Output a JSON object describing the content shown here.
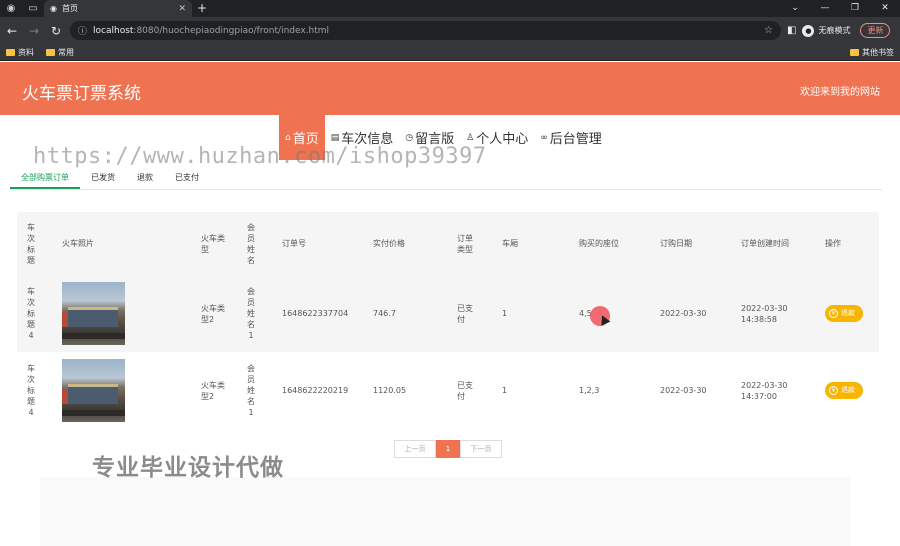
{
  "browser": {
    "tab_title": "首页",
    "url_host": "localhost",
    "url_path": ":8080/huochepiaodingpiao/front/index.html",
    "profile_label": "无痕模式",
    "update_label": "更新",
    "bookmarks": [
      "资料",
      "常用"
    ],
    "bookmarks_right": "其他书签"
  },
  "site": {
    "title": "火车票订票系统",
    "welcome": "欢迎来到我的网站"
  },
  "nav": [
    {
      "label": "首页",
      "icon": "home-icon",
      "active": true
    },
    {
      "label": "车次信息",
      "icon": "train-icon",
      "active": false
    },
    {
      "label": "留言版",
      "icon": "clock-icon",
      "active": false
    },
    {
      "label": "个人中心",
      "icon": "user-icon",
      "active": false
    },
    {
      "label": "后台管理",
      "icon": "link-icon",
      "active": false
    }
  ],
  "watermark_url": "https://www.huzhan.com/ishop39397",
  "watermark_text": "专业毕业设计代做",
  "subtabs": [
    {
      "label": "全部购票订单",
      "active": true
    },
    {
      "label": "已发货",
      "active": false
    },
    {
      "label": "退款",
      "active": false
    },
    {
      "label": "已支付",
      "active": false
    }
  ],
  "table": {
    "headers": {
      "title": "车次标题",
      "img": "火车照片",
      "type": "火车类型",
      "member": "会员姓名",
      "order": "订单号",
      "price": "实付价格",
      "otype": "订单类型",
      "car": "车厢",
      "seat": "购买的座位",
      "date": "订购日期",
      "created": "订单创建时间",
      "op": "操作"
    },
    "rows": [
      {
        "title": "车次标题4",
        "type": "火车类型2",
        "member": "会员姓名1",
        "order": "1648622337704",
        "price": "746.7",
        "otype": "已支付",
        "car": "1",
        "seat": "4,5",
        "date": "2022-03-30",
        "created_date": "2022-03-30",
        "created_time": "14:38:58",
        "op": "退款"
      },
      {
        "title": "车次标题4",
        "type": "火车类型2",
        "member": "会员姓名1",
        "order": "1648622220219",
        "price": "1120.05",
        "otype": "已支付",
        "car": "1",
        "seat": "1,2,3",
        "date": "2022-03-30",
        "created_date": "2022-03-30",
        "created_time": "14:37:00",
        "op": "退款"
      }
    ]
  },
  "pager": {
    "prev": "上一页",
    "current": "1",
    "next": "下一页"
  }
}
